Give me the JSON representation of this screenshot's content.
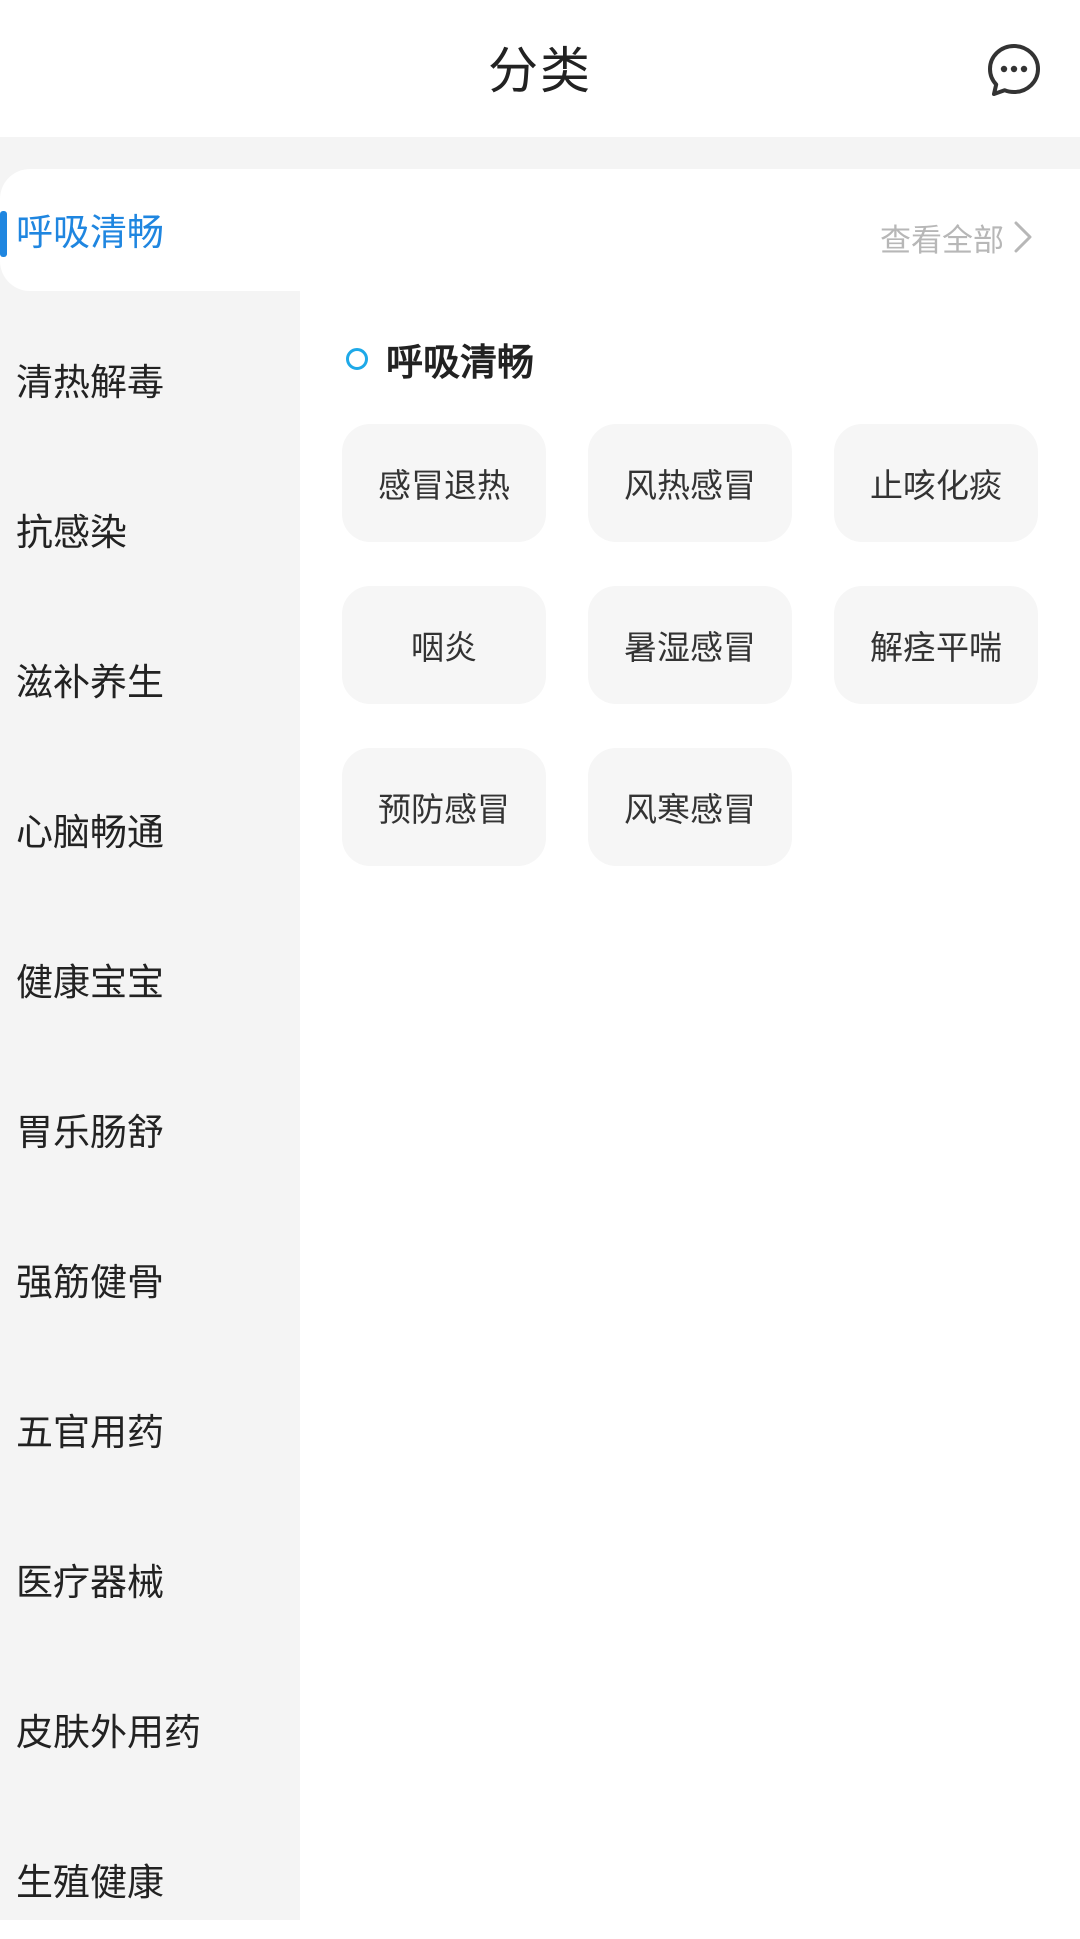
{
  "header": {
    "title": "分类",
    "message_icon": "chat-bubble-icon"
  },
  "sidebar": {
    "active_index": 0,
    "items": [
      {
        "label": "呼吸清畅"
      },
      {
        "label": "清热解毒"
      },
      {
        "label": "抗感染"
      },
      {
        "label": "滋补养生"
      },
      {
        "label": "心脑畅通"
      },
      {
        "label": "健康宝宝"
      },
      {
        "label": "胃乐肠舒"
      },
      {
        "label": "强筋健骨"
      },
      {
        "label": "五官用药"
      },
      {
        "label": "医疗器械"
      },
      {
        "label": "皮肤外用药"
      },
      {
        "label": "生殖健康"
      }
    ]
  },
  "main": {
    "see_all_label": "查看全部",
    "section_title": "呼吸清畅",
    "subcategories": [
      {
        "label": "感冒退热"
      },
      {
        "label": "风热感冒"
      },
      {
        "label": "止咳化痰"
      },
      {
        "label": "咽炎"
      },
      {
        "label": "暑湿感冒"
      },
      {
        "label": "解痉平喘"
      },
      {
        "label": "预防感冒"
      },
      {
        "label": "风寒感冒"
      }
    ]
  },
  "colors": {
    "accent": "#1f86e0",
    "ring": "#1ea9e8",
    "sidebar_bg": "#f4f4f4",
    "chip_bg": "#f6f6f6"
  }
}
